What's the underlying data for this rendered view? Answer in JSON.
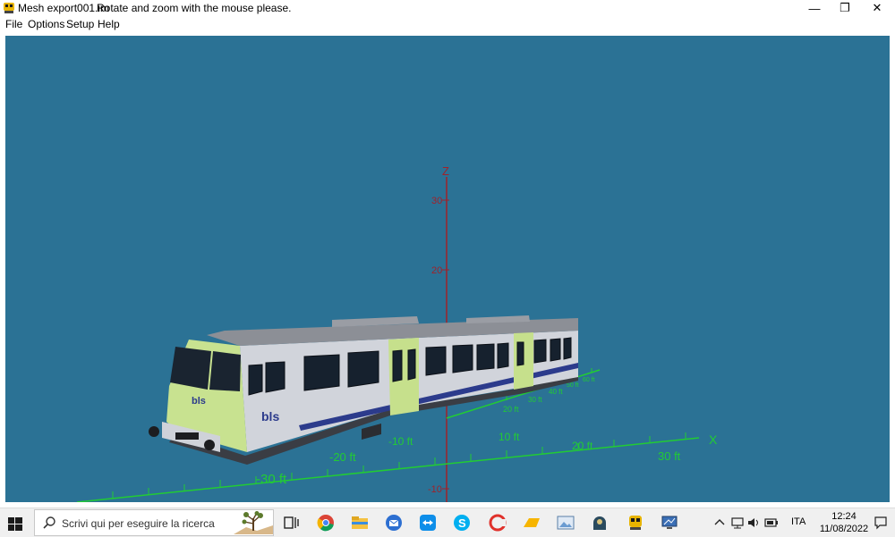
{
  "window": {
    "file_name": "Mesh export001.im",
    "message": "Rotate and zoom with the mouse please.",
    "minimize_glyph": "—",
    "restore_glyph": "❐",
    "close_glyph": "✕"
  },
  "menu": {
    "items": [
      "File",
      "Options",
      "Setup",
      "Help"
    ]
  },
  "scene": {
    "axes": {
      "x_label": "X",
      "z_label": "Z",
      "x_ticks": [
        "10 ft",
        "20 ft",
        "30 ft"
      ],
      "x_neg_ticks": [
        "-10 ft",
        "-20 ft",
        "-30 ft"
      ],
      "y_ticks": [
        "20 ft",
        "30 ft",
        "40 ft",
        "50 ft",
        "60 ft"
      ],
      "z_ticks": [
        "30",
        "20",
        "-10"
      ]
    },
    "train_logo": "bls",
    "colors": {
      "background": "#2b7295",
      "axis_green": "#22cc33",
      "axis_red": "#a0222a",
      "body": "#cfd2d9",
      "roof": "#8c8f96",
      "accent_green": "#c6e08c",
      "stripe_blue": "#2c3b8c"
    }
  },
  "taskbar": {
    "start_icon": "windows-logo-icon",
    "search_placeholder": "Scrivi qui per eseguire la ricerca",
    "apps": [
      "task-view-icon",
      "chrome-icon",
      "file-explorer-icon",
      "thunderbird-icon",
      "teamviewer-icon",
      "skype-icon",
      "ccleaner-icon",
      "folder-yellow-icon",
      "photo-viewer-icon",
      "game-icon",
      "train-app-icon",
      "monitor-app-icon"
    ],
    "tray": {
      "language": "ITA",
      "time": "12:24",
      "date": "11/08/2022"
    }
  }
}
